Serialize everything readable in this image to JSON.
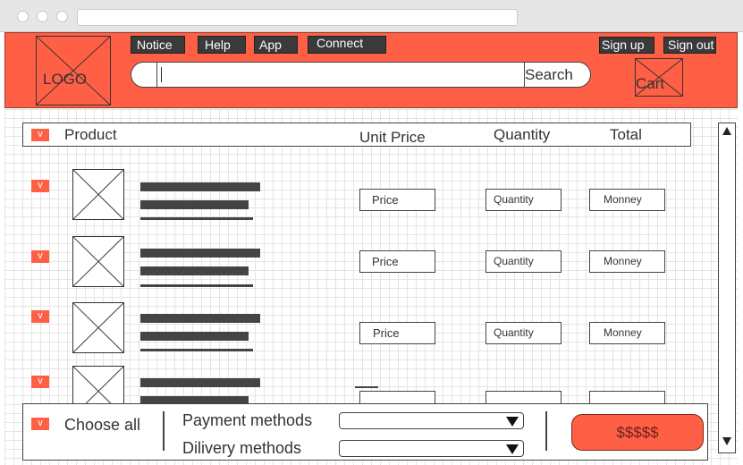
{
  "header": {
    "logo_text": "LOGO",
    "nav": [
      "Notice",
      "Help",
      "App",
      "Connect"
    ],
    "search": {
      "value": "|",
      "button_label": "Search"
    },
    "auth": {
      "signup_label": "Sign up",
      "signout_label": "Sign out"
    },
    "cart_label": "Cart"
  },
  "table": {
    "check_mark": "v",
    "columns": {
      "product": "Product",
      "unit_price": "Unit Price",
      "quantity": "Quantity",
      "total": "Total"
    },
    "rows": [
      {
        "price": "Price",
        "quantity": "Quantity",
        "total": "Monney"
      },
      {
        "price": "Price",
        "quantity": "Quantity",
        "total": "Monney"
      },
      {
        "price": "Price",
        "quantity": "Quantity",
        "total": "Monney"
      },
      {
        "price": "",
        "quantity": "",
        "total": ""
      }
    ]
  },
  "footer": {
    "choose_all_label": "Choose all",
    "payment_label": "Payment methods",
    "delivery_label": "Dilivery methods",
    "pay_button_label": "$$$$$"
  },
  "colors": {
    "accent": "#ff5f45",
    "dark_button": "#3a3a3a"
  }
}
